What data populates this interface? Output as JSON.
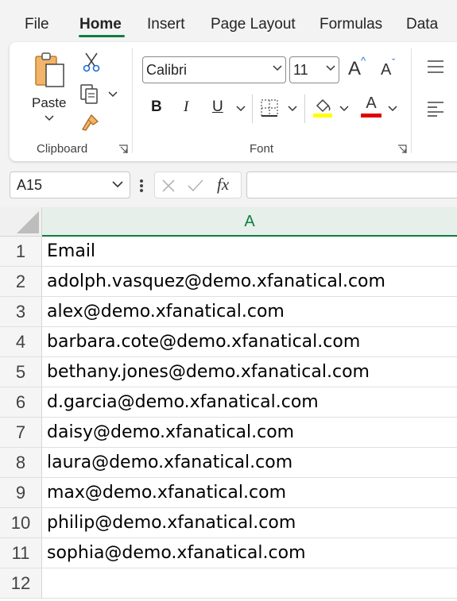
{
  "tabs": {
    "file": "File",
    "home": "Home",
    "insert": "Insert",
    "page_layout": "Page Layout",
    "formulas": "Formulas",
    "data": "Data"
  },
  "ribbon": {
    "clipboard": {
      "paste_label": "Paste",
      "group_label": "Clipboard"
    },
    "font": {
      "font_name": "Calibri",
      "font_size": "11",
      "bold": "B",
      "italic": "I",
      "underline": "U",
      "font_color_glyph": "A",
      "grow_glyph": "A",
      "shrink_glyph": "A",
      "group_label": "Font",
      "highlight_color": "#ffff00",
      "font_color": "#e00000"
    }
  },
  "formula_bar": {
    "name_box": "A15",
    "fx_label": "fx",
    "value": ""
  },
  "sheet": {
    "column_header": "A",
    "accent": "#107c41",
    "rows": [
      {
        "num": "1",
        "value": "Email"
      },
      {
        "num": "2",
        "value": "adolph.vasquez@demo.xfanatical.com"
      },
      {
        "num": "3",
        "value": "alex@demo.xfanatical.com"
      },
      {
        "num": "4",
        "value": "barbara.cote@demo.xfanatical.com"
      },
      {
        "num": "5",
        "value": "bethany.jones@demo.xfanatical.com"
      },
      {
        "num": "6",
        "value": "d.garcia@demo.xfanatical.com"
      },
      {
        "num": "7",
        "value": "daisy@demo.xfanatical.com"
      },
      {
        "num": "8",
        "value": "laura@demo.xfanatical.com"
      },
      {
        "num": "9",
        "value": "max@demo.xfanatical.com"
      },
      {
        "num": "10",
        "value": "philip@demo.xfanatical.com"
      },
      {
        "num": "11",
        "value": "sophia@demo.xfanatical.com"
      },
      {
        "num": "12",
        "value": ""
      }
    ]
  }
}
